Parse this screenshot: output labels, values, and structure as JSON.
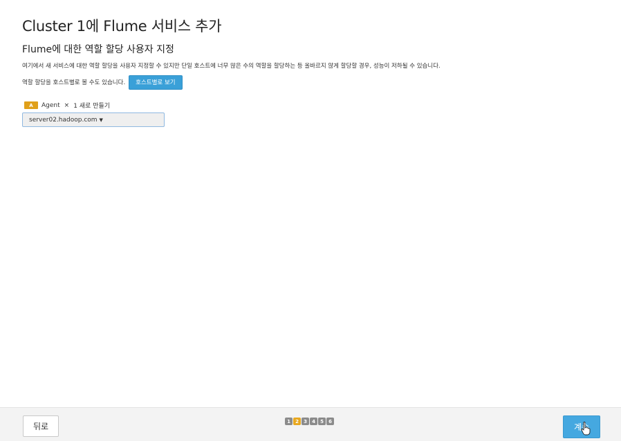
{
  "header": {
    "title": "Cluster 1에 Flume 서비스 추가",
    "subtitle": "Flume에 대한 역할 할당 사용자 지정"
  },
  "description": "여기에서 새 서비스에 대한 역할 할당을 사용자 지정할 수 있지만 단일 호스트에 너무 많은 수의 역할을 할당하는 등 올바르지 않게 할당할 경우, 성능이 저하될 수 있습니다.",
  "view_by_host": {
    "text": "역할 할당을 호스트별로 볼 수도 있습니다.",
    "button_label": "호스트별로 보기"
  },
  "role": {
    "badge": "A",
    "name": "Agent",
    "separator": "×",
    "count_label": "1 새로 만들기",
    "badge_color": "#e0a01a"
  },
  "host_select": {
    "value": "server02.hadoop.com"
  },
  "footer": {
    "back_label": "뒤로",
    "continue_label": "계속",
    "steps": [
      "1",
      "2",
      "3",
      "4",
      "5",
      "6"
    ],
    "active_step": 2,
    "accent_color": "#45a8e0"
  }
}
